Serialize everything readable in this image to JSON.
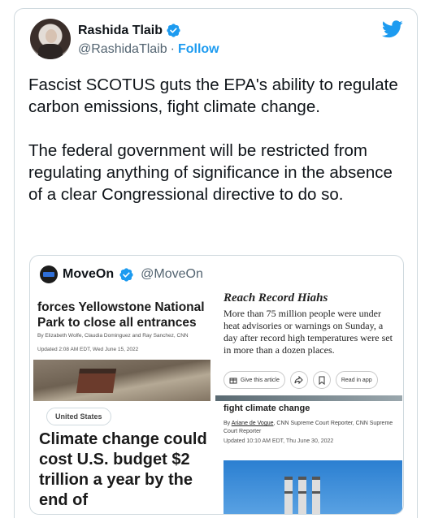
{
  "tweet": {
    "author_name": "Rashida Tlaib",
    "author_handle": "@RashidaTlaib",
    "separator": "·",
    "follow_label": "Follow",
    "text": "Fascist SCOTUS guts the EPA's ability to regulate carbon emissions, fight climate change.\n\nThe federal government will be restricted from regulating anything of significance in the absence of a clear Congressional directive to do so."
  },
  "quoted_tweet": {
    "author_name": "MoveOn",
    "author_handle": "@MoveOn",
    "panels": {
      "top_left": {
        "headline": "forces Yellowstone National Park to close all entrances",
        "byline": "By Elizabeth Wolfe, Claudia Dominguez and Ray Sanchez, CNN",
        "updated": "Updated 2:08 AM EDT, Wed June 15, 2022"
      },
      "top_right": {
        "cut_title": "Reach Record Highs",
        "summary": "More than 75 million people were under heat advisories or warnings on Sunday, a day after record high temperatures were set in more than a dozen places.",
        "give_label": "Give this article",
        "read_label": "Read in app"
      },
      "bottom_left": {
        "tag": "United States",
        "headline": "Climate change could cost U.S. budget $2 trillion a year by the end of"
      },
      "bottom_right": {
        "cut_title": "fight climate change",
        "byline_prefix": "By ",
        "byline_author": "Ariane de Vogue",
        "byline_rest": ", CNN Supreme Court Reporter, CNN Supreme Court Reporter",
        "updated": "Updated 10:10 AM EDT, Thu June 30, 2022"
      }
    }
  },
  "colors": {
    "accent": "#1d9bf0",
    "text": "#0f1419",
    "muted": "#536471",
    "border": "#cfd9de"
  },
  "icons": [
    "verified-badge-icon",
    "twitter-bird-icon",
    "gift-icon",
    "share-icon",
    "bookmark-icon"
  ]
}
